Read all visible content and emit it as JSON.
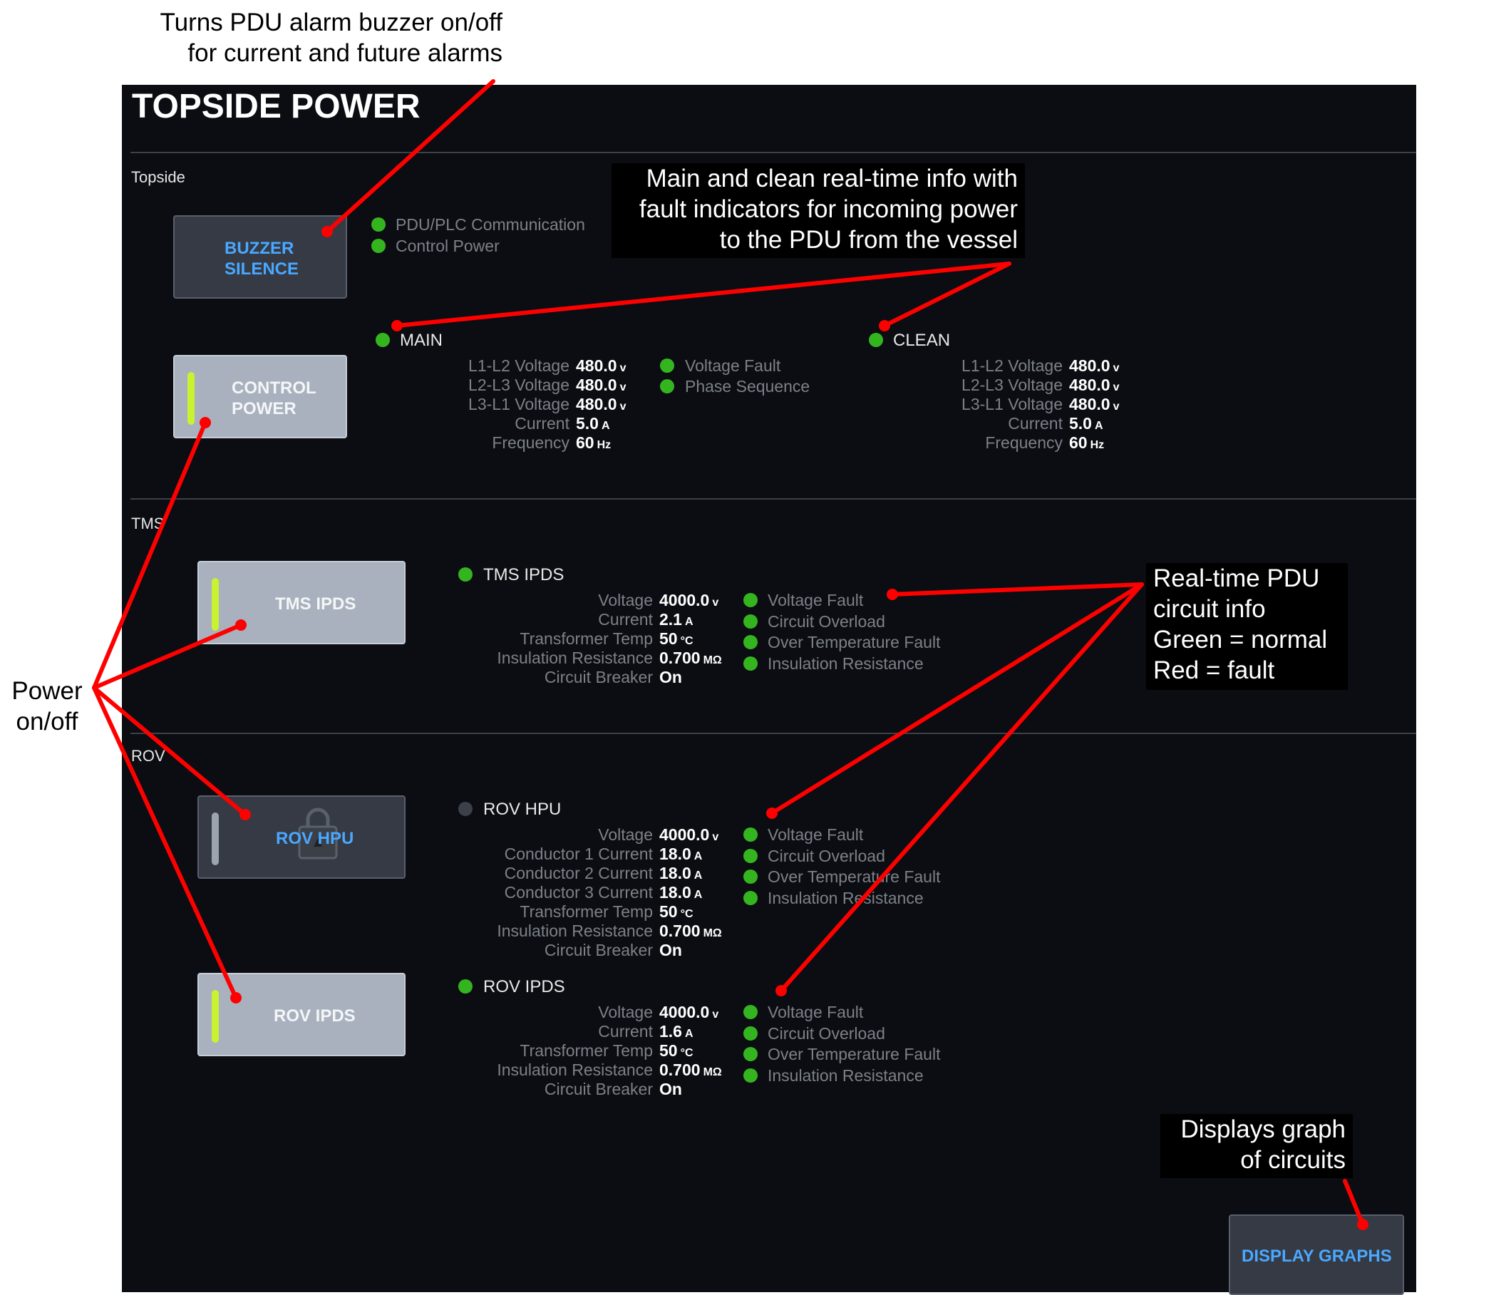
{
  "title": "TOPSIDE POWER",
  "sections": {
    "topside": "Topside",
    "tms": "TMS",
    "rov": "ROV"
  },
  "buttons": {
    "buzzer_silence": [
      "BUZZER",
      "SILENCE"
    ],
    "control_power": [
      "CONTROL",
      "POWER"
    ],
    "tms_ipds": "TMS IPDS",
    "rov_hpu": "ROV HPU",
    "rov_ipds": "ROV IPDS",
    "display_graphs": "DISPLAY GRAPHS"
  },
  "topside_status": {
    "pdu_plc": "PDU/PLC Communication",
    "control_power": "Control Power"
  },
  "main": {
    "name": "MAIN",
    "readings": [
      {
        "label": "L1-L2 Voltage",
        "value": "480.0",
        "unit": "v"
      },
      {
        "label": "L2-L3 Voltage",
        "value": "480.0",
        "unit": "v"
      },
      {
        "label": "L3-L1 Voltage",
        "value": "480.0",
        "unit": "v"
      },
      {
        "label": "Current",
        "value": "5.0",
        "unit": "A"
      },
      {
        "label": "Frequency",
        "value": "60",
        "unit": "Hz"
      }
    ],
    "faults": [
      "Voltage Fault",
      "Phase Sequence"
    ]
  },
  "clean": {
    "name": "CLEAN",
    "readings": [
      {
        "label": "L1-L2 Voltage",
        "value": "480.0",
        "unit": "v"
      },
      {
        "label": "L2-L3 Voltage",
        "value": "480.0",
        "unit": "v"
      },
      {
        "label": "L3-L1 Voltage",
        "value": "480.0",
        "unit": "v"
      },
      {
        "label": "Current",
        "value": "5.0",
        "unit": "A"
      },
      {
        "label": "Frequency",
        "value": "60",
        "unit": "Hz"
      }
    ]
  },
  "tms_ipds": {
    "name": "TMS IPDS",
    "readings": [
      {
        "label": "Voltage",
        "value": "4000.0",
        "unit": "v"
      },
      {
        "label": "Current",
        "value": "2.1",
        "unit": "A"
      },
      {
        "label": "Transformer Temp",
        "value": "50",
        "unit": "°C"
      },
      {
        "label": "Insulation Resistance",
        "value": "0.700",
        "unit": "MΩ"
      },
      {
        "label": "Circuit Breaker",
        "value": "On",
        "unit": ""
      }
    ],
    "faults": [
      "Voltage Fault",
      "Circuit Overload",
      "Over Temperature Fault",
      "Insulation Resistance"
    ]
  },
  "rov_hpu": {
    "name": "ROV HPU",
    "readings": [
      {
        "label": "Voltage",
        "value": "4000.0",
        "unit": "v"
      },
      {
        "label": "Conductor 1 Current",
        "value": "18.0",
        "unit": "A"
      },
      {
        "label": "Conductor 2 Current",
        "value": "18.0",
        "unit": "A"
      },
      {
        "label": "Conductor 3 Current",
        "value": "18.0",
        "unit": "A"
      },
      {
        "label": "Transformer Temp",
        "value": "50",
        "unit": "°C"
      },
      {
        "label": "Insulation Resistance",
        "value": "0.700",
        "unit": "MΩ"
      },
      {
        "label": "Circuit Breaker",
        "value": "On",
        "unit": ""
      }
    ],
    "faults": [
      "Voltage Fault",
      "Circuit Overload",
      "Over Temperature Fault",
      "Insulation Resistance"
    ]
  },
  "rov_ipds": {
    "name": "ROV IPDS",
    "readings": [
      {
        "label": "Voltage",
        "value": "4000.0",
        "unit": "v"
      },
      {
        "label": "Current",
        "value": "1.6",
        "unit": "A"
      },
      {
        "label": "Transformer Temp",
        "value": "50",
        "unit": "°C"
      },
      {
        "label": "Insulation Resistance",
        "value": "0.700",
        "unit": "MΩ"
      },
      {
        "label": "Circuit Breaker",
        "value": "On",
        "unit": ""
      }
    ],
    "faults": [
      "Voltage Fault",
      "Circuit Overload",
      "Over Temperature Fault",
      "Insulation Resistance"
    ]
  },
  "annotations": {
    "buzzer": [
      "Turns PDU alarm buzzer on/off",
      "for current and future alarms"
    ],
    "main_clean": [
      "Main and clean real-time info with",
      "fault indicators for incoming power",
      "to the PDU from the vessel"
    ],
    "circuit": [
      "Real-time PDU",
      "circuit info",
      "Green = normal",
      "Red = fault"
    ],
    "power": [
      "Power",
      "on/off"
    ],
    "graphs": [
      "Displays graph",
      "of circuits"
    ]
  },
  "colors": {
    "status_ok": "#34b51f",
    "status_off": "#3c4048",
    "power_on_bar": "#c9f230",
    "annotation_line": "#ff0000"
  }
}
